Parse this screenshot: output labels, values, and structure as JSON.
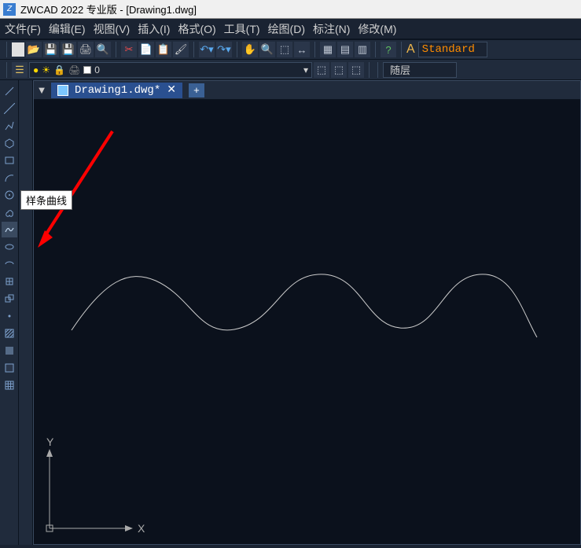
{
  "titlebar": {
    "title": "ZWCAD 2022 专业版 - [Drawing1.dwg]"
  },
  "menu": {
    "file": "文件(F)",
    "edit": "编辑(E)",
    "view": "视图(V)",
    "insert": "插入(I)",
    "format": "格式(O)",
    "tools": "工具(T)",
    "draw": "绘图(D)",
    "annotate": "标注(N)",
    "modify": "修改(M)"
  },
  "layer": {
    "name": "0"
  },
  "style": {
    "current": "Standard"
  },
  "rightCombo": {
    "label": "随层"
  },
  "tab": {
    "label": "Drawing1.dwg*",
    "close": "✕",
    "new": "+"
  },
  "axis": {
    "x": "X",
    "y": "Y"
  },
  "tooltip": {
    "text": "样条曲线"
  }
}
